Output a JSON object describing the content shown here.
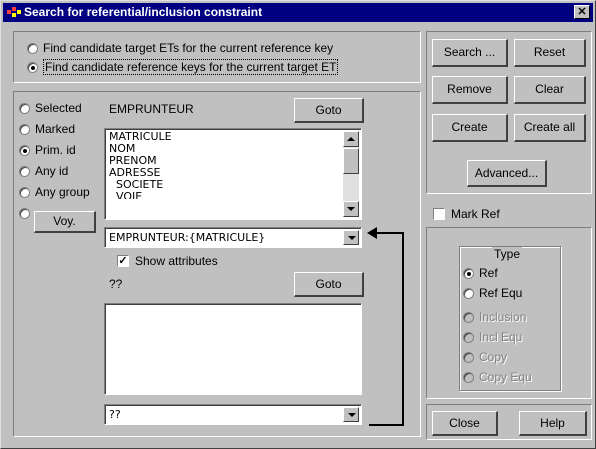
{
  "window": {
    "title": "Search for referential/inclusion constraint",
    "close_glyph": "✕"
  },
  "mode": {
    "option_target": "Find candidate target ETs for the current reference key",
    "option_ref": "Find candidate reference keys for the current target ET",
    "selected": "option_ref"
  },
  "selector": {
    "options": [
      "Selected",
      "Marked",
      "Prim. id",
      "Any id",
      "Any group"
    ],
    "selected": "Prim. id",
    "voy_button": "Voy."
  },
  "entity": {
    "name": "EMPRUNTEUR",
    "goto_label": "Goto",
    "attributes": [
      "MATRICULE",
      "NOM",
      "PRENOM",
      "ADRESSE",
      "  SOCIETE",
      "  VOIE"
    ],
    "key_combo": "EMPRUNTEUR:{MATRICULE}"
  },
  "target": {
    "show_attributes_label": "Show attributes",
    "show_attributes_checked": true,
    "name": "??",
    "goto_label": "Goto",
    "key_combo": "??"
  },
  "actions": {
    "search": "Search ...",
    "reset": "Reset",
    "remove": "Remove",
    "clear": "Clear",
    "create": "Create",
    "create_all": "Create all",
    "advanced": "Advanced...",
    "mark_ref": "Mark Ref",
    "close": "Close",
    "help": "Help"
  },
  "type_group": {
    "title": "Type",
    "options": [
      "Ref",
      "Ref Equ",
      "Inclusion",
      "Incl Equ",
      "Copy",
      "Copy Equ"
    ],
    "enabled": [
      true,
      true,
      false,
      false,
      false,
      false
    ],
    "selected": "Ref"
  }
}
